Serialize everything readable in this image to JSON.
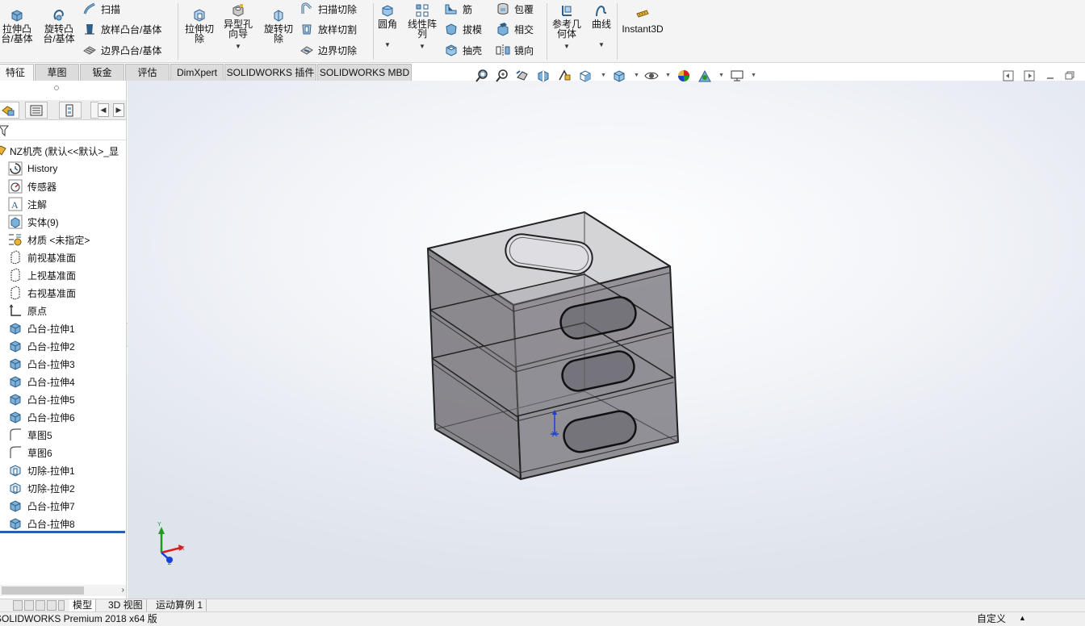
{
  "ribbon": {
    "extrude_boss": "拉伸凸\n台/基体",
    "revolve_boss": "旋转凸\n台/基体",
    "sweep": "扫描",
    "loft_boss": "放样凸台/基体",
    "boundary_boss": "边界凸台/基体",
    "extrude_cut": "拉伸切\n除",
    "hole_wizard": "异型孔\n向导",
    "revolve_cut": "旋转切\n除",
    "swept_cut": "扫描切除",
    "lofted_cut": "放样切割",
    "boundary_cut": "边界切除",
    "fillet": "圆角",
    "linear_pattern": "线性阵\n列",
    "rib": "筋",
    "draft": "拔模",
    "shell": "抽壳",
    "wrap": "包覆",
    "intersect": "相交",
    "mirror": "镜向",
    "ref_geometry": "参考几\n何体",
    "curves": "曲线",
    "instant3d": "Instant3D"
  },
  "command_tabs": [
    "特征",
    "草图",
    "钣金",
    "评估",
    "DimXpert",
    "SOLIDWORKS 插件",
    "SOLIDWORKS MBD"
  ],
  "feature_tree": {
    "root": "NZ机壳  (默认<<默认>_显",
    "items": [
      {
        "label": "History",
        "icon": "history-icon"
      },
      {
        "label": "传感器",
        "icon": "sensor-icon"
      },
      {
        "label": "注解",
        "icon": "annotation-icon"
      },
      {
        "label": "实体(9)",
        "icon": "solid-bodies-icon"
      },
      {
        "label": "材质 <未指定>",
        "icon": "material-icon"
      },
      {
        "label": "前视基准面",
        "icon": "plane-icon"
      },
      {
        "label": "上视基准面",
        "icon": "plane-icon"
      },
      {
        "label": "右视基准面",
        "icon": "plane-icon"
      },
      {
        "label": "原点",
        "icon": "origin-icon"
      },
      {
        "label": "凸台-拉伸1",
        "icon": "boss-extrude-icon"
      },
      {
        "label": "凸台-拉伸2",
        "icon": "boss-extrude-icon"
      },
      {
        "label": "凸台-拉伸3",
        "icon": "boss-extrude-icon"
      },
      {
        "label": "凸台-拉伸4",
        "icon": "boss-extrude-icon"
      },
      {
        "label": "凸台-拉伸5",
        "icon": "boss-extrude-icon"
      },
      {
        "label": "凸台-拉伸6",
        "icon": "boss-extrude-icon"
      },
      {
        "label": "草图5",
        "icon": "sketch-icon"
      },
      {
        "label": "草图6",
        "icon": "sketch-icon"
      },
      {
        "label": "切除-拉伸1",
        "icon": "cut-extrude-icon"
      },
      {
        "label": "切除-拉伸2",
        "icon": "cut-extrude-icon"
      },
      {
        "label": "凸台-拉伸7",
        "icon": "boss-extrude-icon"
      },
      {
        "label": "凸台-拉伸8",
        "icon": "boss-extrude-icon"
      }
    ]
  },
  "triad": {
    "x": "X",
    "y": "Y",
    "z": "Z"
  },
  "bottom_tabs": [
    "模型",
    "3D 视图",
    "运动算例 1"
  ],
  "status": {
    "app": "SOLIDWORKS Premium 2018 x64 版",
    "units": "自定义",
    "up_arrow": "▲"
  }
}
